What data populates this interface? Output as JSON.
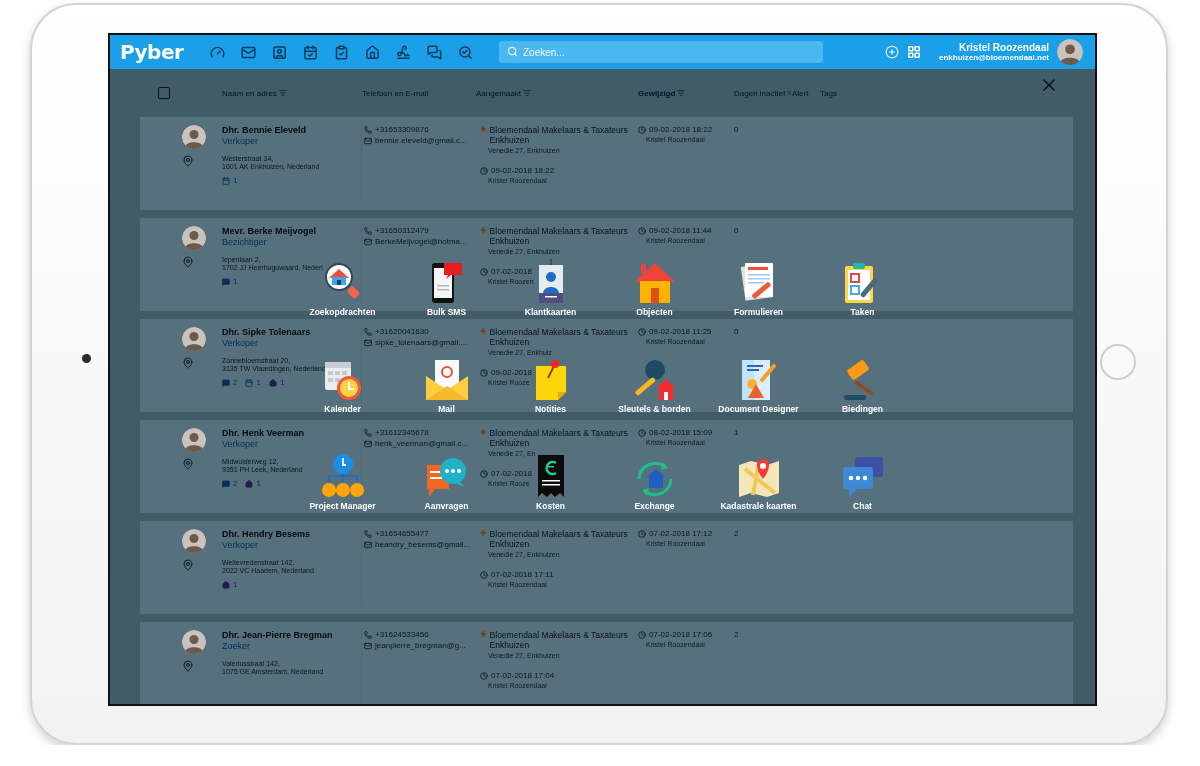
{
  "header": {
    "logo": "Pyber",
    "search": {
      "placeholder": "Zoeken..."
    },
    "user": {
      "name": "Kristel Roozendaal",
      "email": "enkhuizen@bloemendaal.net"
    }
  },
  "table": {
    "select_all": {
      "checked": false
    },
    "columns": [
      {
        "label": "Naam en adres",
        "sortable": true,
        "selected": false
      },
      {
        "label": "Telefoon en E-mail",
        "sortable": false,
        "selected": false
      },
      {
        "label": "Aangemaakt",
        "sortable": true,
        "selected": false
      },
      {
        "label": "Gewijzigd",
        "sortable": true,
        "selected": true
      },
      {
        "label": "Dagen inactief",
        "sortable": true,
        "selected": false
      },
      {
        "label": "Alert",
        "sortable": false,
        "selected": false
      },
      {
        "label": "Tags",
        "sortable": false,
        "selected": false
      }
    ],
    "rows": [
      {
        "name": "Dhr. Bennie Eleveld",
        "role": "Verkoper",
        "address": [
          "Westerstraat 34,",
          "1601 AK Enkhuizen, Nederland"
        ],
        "badges": [
          {
            "kind": "calendar",
            "count": "1"
          }
        ],
        "phone": "+31653309876",
        "email": "bennie.eleveld@gmail.c...",
        "office": "Bloemendaal Makelaars & Taxateurs Enkhuizen",
        "office_address": "Venedie 27, Enkhuizen",
        "created": "09-02-2018 18:22",
        "created_by": "Kristel Roozendaal",
        "modified": "09-02-2018 18:22",
        "modified_by": "Kristel Roozendaal",
        "days": "0"
      },
      {
        "name": "Mevr. Berke Meijvogel",
        "role": "Bezichtiger",
        "address": [
          "Iepenlaan 2,",
          "1702 JJ Heerhugowaard, Nederl"
        ],
        "badges": [
          {
            "kind": "chat",
            "count": "1"
          }
        ],
        "phone": "+31650312479",
        "email": "BerkeMeijvogel@hotma...",
        "office": "Bloemendaal Makelaars & Taxateurs Enkhuizen",
        "office_address": "Venedie 27, Enkhuizen",
        "created": "07-02-2018",
        "created_by": "Kristel Roozen",
        "modified": "09-02-2018 11:44",
        "modified_by": "Kristel Roozendaal",
        "days": "0"
      },
      {
        "name": "Dhr. Sipke Tolenaars",
        "role": "Verkoper",
        "address": [
          "Zonnebloemstraat 20,",
          "3135 TW Vlaardingen, Nederland"
        ],
        "badges": [
          {
            "kind": "chat",
            "count": "2"
          },
          {
            "kind": "calendar",
            "count": "1"
          },
          {
            "kind": "home",
            "count": "1"
          }
        ],
        "phone": "+31620041630",
        "email": "sipke_tolenaars@gmail....",
        "office": "Bloemendaal Makelaars & Taxateurs Enkhuizen",
        "office_address": "Venedie 27, Enkhuiz",
        "created": "09-02-2018",
        "created_by": "Kristel Rooze",
        "modified": "09-02-2018 11:25",
        "modified_by": "Kristel Roozendaal",
        "days": "0"
      },
      {
        "name": "Dhr. Henk Veerman",
        "role": "Verkoper",
        "address": [
          "Midwolderweg 12,",
          "9351 PH Leek, Nederland"
        ],
        "badges": [
          {
            "kind": "chat",
            "count": "2"
          },
          {
            "kind": "home",
            "count": "1"
          }
        ],
        "phone": "+31612345678",
        "email": "henk_veerman@gmail.c...",
        "office": "Bloemendaal Makelaars & Taxateurs Enkhuizen",
        "office_address": "Venedie 27, En",
        "created": "07-02-2018",
        "created_by": "Kristel Rooze",
        "modified": "08-02-2018 15:09",
        "modified_by": "Kristel Roozendaal",
        "days": "1"
      },
      {
        "name": "Dhr. Hendry Besems",
        "role": "Verkoper",
        "address": [
          "Weltevredenstraat 142,",
          "2022 VC Haarlem, Nederland"
        ],
        "badges": [
          {
            "kind": "home",
            "count": "1"
          }
        ],
        "phone": "+31654655477",
        "email": "heandry_besems@gmail...",
        "office": "Bloemendaal Makelaars & Taxateurs Enkhuizen",
        "office_address": "Venedie 27, Enkhuizen",
        "created": "07-02-2018 17:11",
        "created_by": "Kristel Roozendaal",
        "modified": "07-02-2018 17:12",
        "modified_by": "Kristel Roozendaal",
        "days": "2"
      },
      {
        "name": "Dhr. Jean-Pierre Bregman",
        "role": "Zoeker",
        "address": [
          "Valeriusstraat 142,",
          "1075 GE Amsterdam, Nederland"
        ],
        "badges": [],
        "phone": "+31624533456",
        "email": "jeanpierre_bregman@g...",
        "office": "Bloemendaal Makelaars & Taxateurs Enkhuizen",
        "office_address": "Venedie 27, Enkhuizen",
        "created": "07-02-2018 17:04",
        "created_by": "Kristel Roozendaal",
        "modified": "07-02-2018 17:06",
        "modified_by": "Kristel Roozendaal",
        "days": "2"
      }
    ]
  },
  "apps": [
    {
      "label": "Zoekopdrachten"
    },
    {
      "label": "Bulk SMS"
    },
    {
      "label": "Klantkaarten"
    },
    {
      "label": "Objecten"
    },
    {
      "label": "Formulieren"
    },
    {
      "label": "Taken"
    },
    {
      "label": "Kalender"
    },
    {
      "label": "Mail"
    },
    {
      "label": "Notities"
    },
    {
      "label": "Sleutels & borden"
    },
    {
      "label": "Document Designer"
    },
    {
      "label": "Biedingen"
    },
    {
      "label": "Project Manager"
    },
    {
      "label": "Aanvragen"
    },
    {
      "label": "Kosten"
    },
    {
      "label": "Exchange"
    },
    {
      "label": "Kadastrale kaarten"
    },
    {
      "label": "Chat"
    }
  ]
}
